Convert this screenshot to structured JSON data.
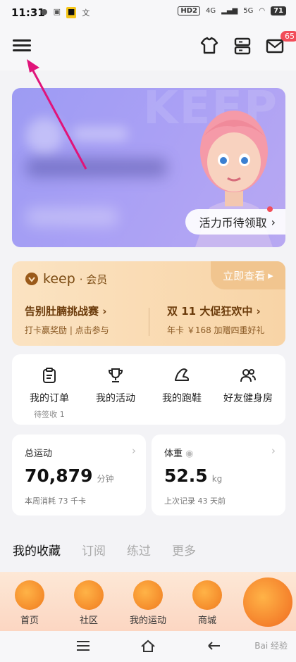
{
  "status": {
    "time": "11:31",
    "left_icons": [
      "message-icon",
      "image-icon",
      "app-icon",
      "wen-icon"
    ],
    "hd": "HD2",
    "sig1": "4G",
    "sig2": "5G",
    "battery": "71"
  },
  "header": {
    "badge_count": "65"
  },
  "banner": {
    "watermark": "KEEP",
    "coin_label": "活力币待领取",
    "coin_chevron": "›"
  },
  "member": {
    "brand": "keep",
    "vip_label": "· 会员",
    "view_label": "立即查看",
    "view_arrow": "▸",
    "promos": [
      {
        "title": "告别肚腩挑战赛 ›",
        "sub": "打卡赢奖励 | 点击参与"
      },
      {
        "title": "双 11 大促狂欢中 ›",
        "sub": "年卡 ￥168 加赠四重好礼"
      }
    ]
  },
  "shortcuts": [
    {
      "label": "我的订单",
      "sub": "待签收 1",
      "icon": "clipboard-icon"
    },
    {
      "label": "我的活动",
      "sub": "",
      "icon": "trophy-icon"
    },
    {
      "label": "我的跑鞋",
      "sub": "",
      "icon": "shoe-icon"
    },
    {
      "label": "好友健身房",
      "sub": "",
      "icon": "friends-icon"
    }
  ],
  "stats": {
    "exercise": {
      "title": "总运动",
      "value": "70,879",
      "unit": "分钟",
      "foot": "本周消耗 73 千卡"
    },
    "weight": {
      "title": "体重",
      "value": "52.5",
      "unit": "kg",
      "foot": "上次记录 43 天前"
    }
  },
  "tabs": [
    {
      "label": "我的收藏",
      "active": true
    },
    {
      "label": "订阅",
      "active": false
    },
    {
      "label": "练过",
      "active": false
    },
    {
      "label": "更多",
      "active": false
    }
  ],
  "nav": [
    {
      "label": "首页"
    },
    {
      "label": "社区"
    },
    {
      "label": "我的运动"
    },
    {
      "label": "商城"
    }
  ],
  "sysnav": {
    "watermark": "Bai 经验"
  },
  "colors": {
    "accent": "#f24d5a",
    "banner": "#a9a0f5",
    "member": "#f8d4a6"
  }
}
